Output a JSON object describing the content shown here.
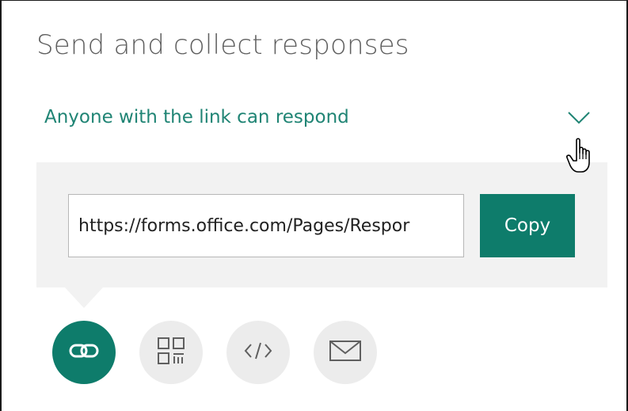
{
  "dialog": {
    "title": "Send and collect responses",
    "permission": {
      "selected": "Anyone with the link can respond",
      "dropdown_icon": "chevron-down-icon"
    }
  },
  "link_panel": {
    "url": "https://forms.office.com/Pages/Respor",
    "copy_label": "Copy"
  },
  "share_options": [
    {
      "name": "link",
      "icon": "link-icon",
      "active": true
    },
    {
      "name": "qr-code",
      "icon": "qr-code-icon",
      "active": false
    },
    {
      "name": "embed",
      "icon": "embed-code-icon",
      "active": false
    },
    {
      "name": "email",
      "icon": "envelope-icon",
      "active": false
    }
  ],
  "colors": {
    "accent": "#0e7c6b",
    "accent_text": "#1f8474",
    "panel_bg": "#f2f2f2",
    "inactive_circle": "#ececec",
    "title_text": "#5f5f5f"
  }
}
